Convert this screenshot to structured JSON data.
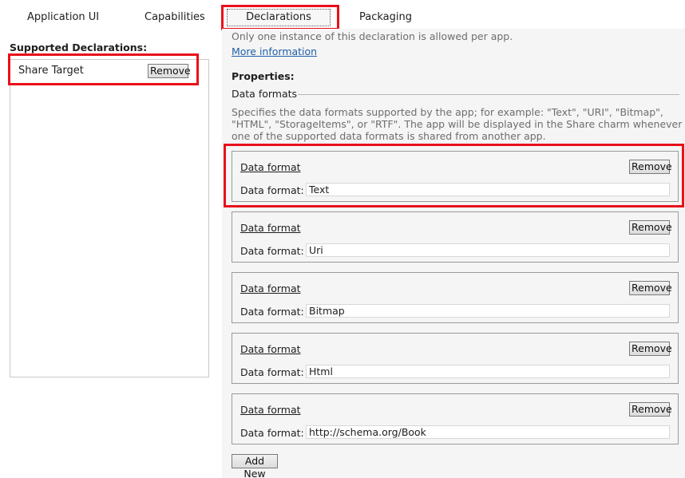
{
  "tabs": [
    {
      "label": "Application UI"
    },
    {
      "label": "Capabilities"
    },
    {
      "label": "Declarations"
    },
    {
      "label": "Packaging"
    }
  ],
  "left": {
    "title": "Supported Declarations:",
    "items": [
      {
        "label": "Share Target",
        "remove_label": "Remove"
      }
    ]
  },
  "right": {
    "note": "Only one instance of this declaration is allowed per app.",
    "more_info": "More information",
    "properties_title": "Properties:",
    "section_title": "Data formats",
    "description": "Specifies the data formats supported by the app; for example: \"Text\", \"URI\", \"Bitmap\", \"HTML\", \"StorageItems\", or \"RTF\". The app will be displayed in the Share charm whenever one of the supported data formats is shared from another app.",
    "formats": [
      {
        "heading": "Data format",
        "remove_label": "Remove",
        "field_label": "Data format:",
        "value": "Text"
      },
      {
        "heading": "Data format",
        "remove_label": "Remove",
        "field_label": "Data format:",
        "value": "Uri"
      },
      {
        "heading": "Data format",
        "remove_label": "Remove",
        "field_label": "Data format:",
        "value": "Bitmap"
      },
      {
        "heading": "Data format",
        "remove_label": "Remove",
        "field_label": "Data format:",
        "value": "Html"
      },
      {
        "heading": "Data format",
        "remove_label": "Remove",
        "field_label": "Data format:",
        "value": "http://schema.org/Book"
      }
    ],
    "add_new_label": "Add New"
  },
  "colors": {
    "highlight": "#e8101a",
    "link": "#1f5fa8"
  }
}
